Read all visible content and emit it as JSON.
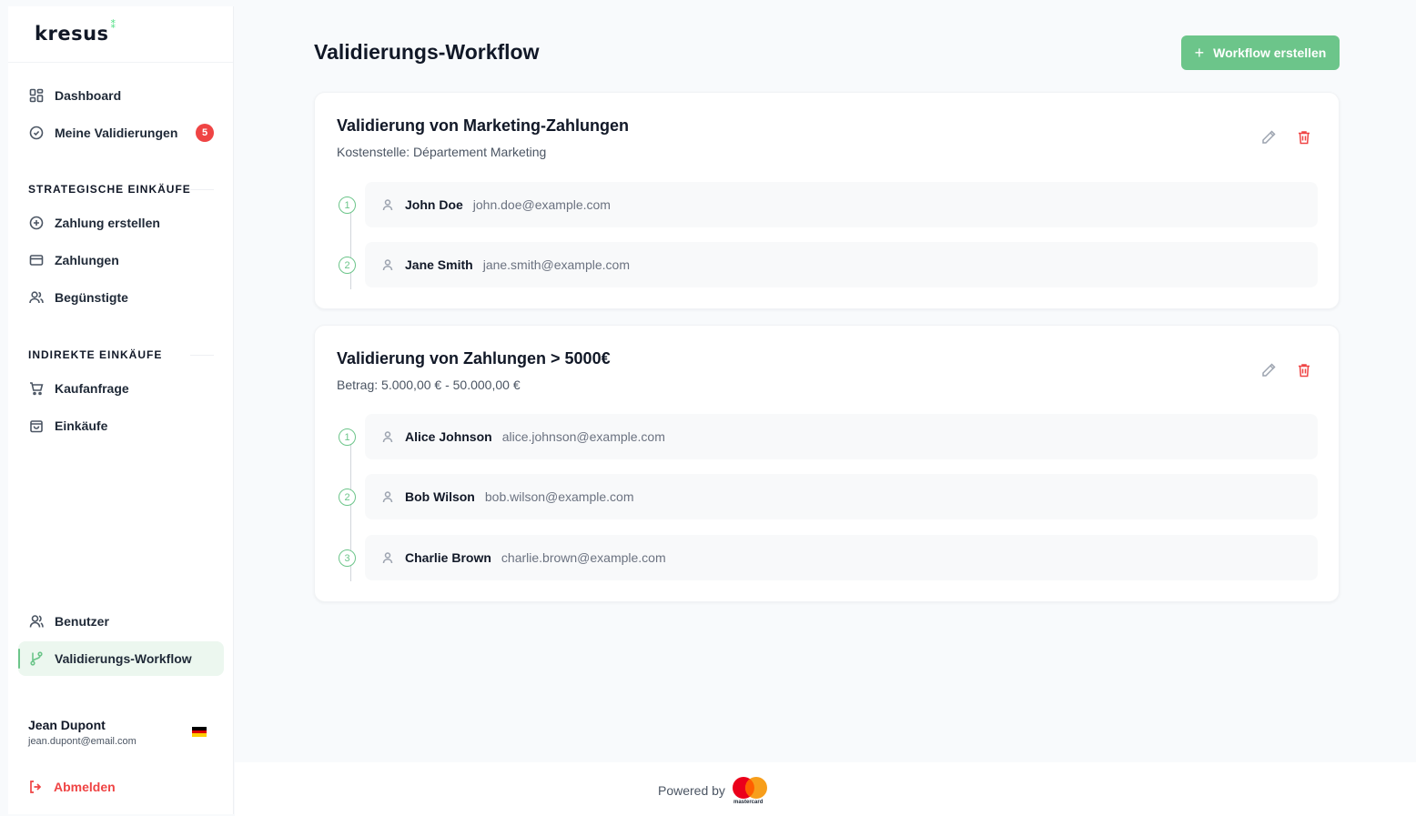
{
  "app": {
    "logo": "kresus",
    "logo_mark": "⁑"
  },
  "sidebar": {
    "main_items": [
      {
        "label": "Dashboard",
        "icon": "dashboard-icon"
      },
      {
        "label": "Meine Validierungen",
        "icon": "check-circle-icon",
        "badge": "5"
      }
    ],
    "section_strategic": "STRATEGISCHE EINKÄUFE",
    "strategic_items": [
      {
        "label": "Zahlung erstellen",
        "icon": "plus-circle-icon"
      },
      {
        "label": "Zahlungen",
        "icon": "credit-card-icon"
      },
      {
        "label": "Begünstigte",
        "icon": "users-icon"
      }
    ],
    "section_indirect": "INDIREKTE EINKÄUFE",
    "indirect_items": [
      {
        "label": "Kaufanfrage",
        "icon": "cart-icon"
      },
      {
        "label": "Einkäufe",
        "icon": "shopping-bag-icon"
      }
    ],
    "bottom_items": [
      {
        "label": "Benutzer",
        "icon": "user-icon"
      },
      {
        "label": "Validierungs-Workflow",
        "icon": "workflow-icon",
        "active": true
      }
    ],
    "user": {
      "name": "Jean Dupont",
      "email": "jean.dupont@email.com",
      "flag": "de-flag-icon"
    },
    "logout_label": "Abmelden"
  },
  "main": {
    "title": "Validierungs-Workflow",
    "create_button": "Workflow erstellen",
    "workflows": [
      {
        "title": "Validierung von Marketing-Zahlungen",
        "subtitle": "Kostenstelle: Département Marketing",
        "steps": [
          {
            "num": "1",
            "name": "John Doe",
            "email": "john.doe@example.com"
          },
          {
            "num": "2",
            "name": "Jane Smith",
            "email": "jane.smith@example.com"
          }
        ]
      },
      {
        "title": "Validierung von Zahlungen > 5000€",
        "subtitle": "Betrag: 5.000,00 € - 50.000,00 €",
        "steps": [
          {
            "num": "1",
            "name": "Alice Johnson",
            "email": "alice.johnson@example.com"
          },
          {
            "num": "2",
            "name": "Bob Wilson",
            "email": "bob.wilson@example.com"
          },
          {
            "num": "3",
            "name": "Charlie Brown",
            "email": "charlie.brown@example.com"
          }
        ]
      }
    ]
  },
  "footer": {
    "powered_by": "Powered by",
    "brand": "mastercard"
  },
  "colors": {
    "accent": "#6cc58a",
    "danger": "#ef4444",
    "active_bg": "#ecf7ef"
  }
}
